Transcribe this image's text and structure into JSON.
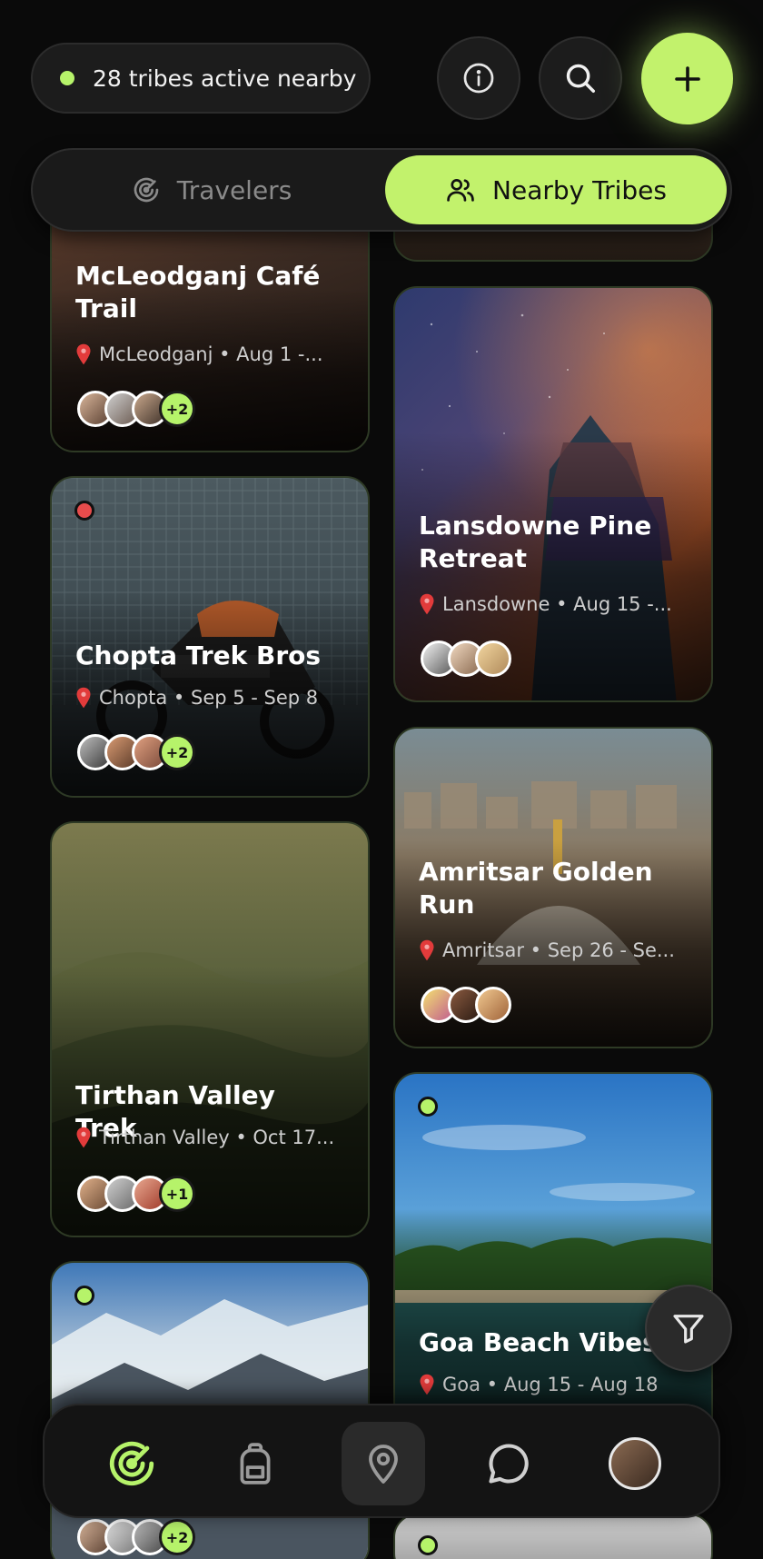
{
  "header": {
    "status_text": "28 tribes active nearby",
    "info_icon": "info-icon",
    "search_icon": "search-icon",
    "add_icon": "plus-icon"
  },
  "tabs": [
    {
      "label": "Travelers",
      "icon": "radar-icon",
      "selected": false
    },
    {
      "label": "Nearby Tribes",
      "icon": "users-icon",
      "selected": true
    }
  ],
  "cards": [
    {
      "title": "McLeodganj Café Trail",
      "meta": "McLeodganj • Aug 1 -...",
      "more": "+2",
      "status": "none"
    },
    {
      "title": "Lansdowne Pine Retreat",
      "meta": "Lansdowne • Aug 15 -...",
      "more": "",
      "status": "none"
    },
    {
      "title": "Chopta Trek Bros",
      "meta": "Chopta • Sep 5 - Sep 8",
      "more": "+2",
      "status": "red"
    },
    {
      "title": "Amritsar Golden Run",
      "meta": "Amritsar • Sep 26 - Se...",
      "more": "",
      "status": "none"
    },
    {
      "title": "Tirthan Valley Trek",
      "meta": "Tirthan Valley • Oct 17...",
      "more": "+1",
      "status": "none"
    },
    {
      "title": "Goa Beach Vibes",
      "meta": "Goa • Aug 15 - Aug 18",
      "more": "",
      "status": "green"
    },
    {
      "title": "",
      "meta": "",
      "more": "+2",
      "status": "green"
    },
    {
      "title": "",
      "meta": "",
      "more": "",
      "status": "green"
    }
  ],
  "colors": {
    "accent": "#c2f26c",
    "live": "#b6f36a",
    "busy": "#e74c4c",
    "background": "#0a0a0a"
  },
  "nav": [
    {
      "name": "radar",
      "icon": "radar-icon",
      "active": true
    },
    {
      "name": "trips",
      "icon": "backpack-icon",
      "active": false
    },
    {
      "name": "map",
      "icon": "map-pin-icon",
      "active": false
    },
    {
      "name": "chat",
      "icon": "chat-icon",
      "active": false
    },
    {
      "name": "profile",
      "icon": "profile-avatar",
      "active": false
    }
  ],
  "filter_icon": "filter-icon"
}
